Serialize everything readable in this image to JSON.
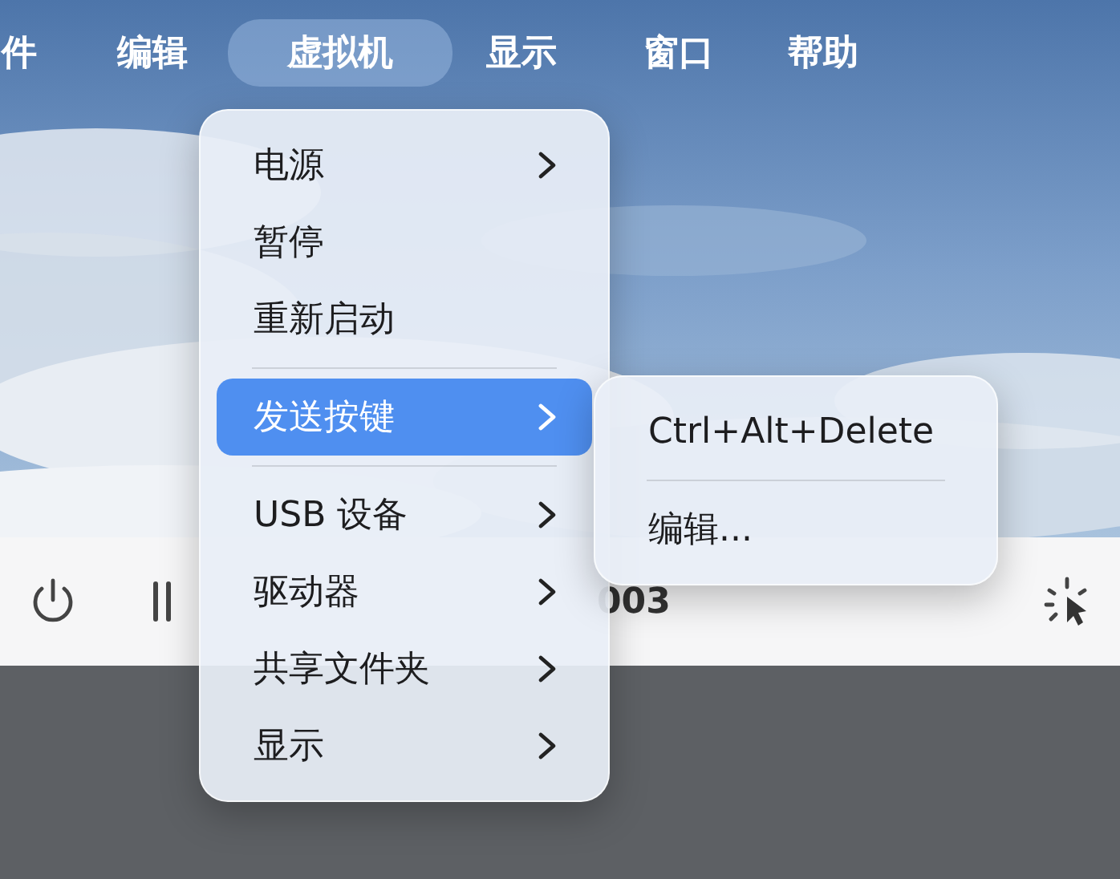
{
  "menu_bar": [
    {
      "label": "件",
      "selected": false
    },
    {
      "label": "编辑",
      "selected": false
    },
    {
      "label": "虚拟机",
      "selected": true
    },
    {
      "label": "显示",
      "selected": false
    },
    {
      "label": "窗口",
      "selected": false
    },
    {
      "label": "帮助",
      "selected": false
    }
  ],
  "menu": {
    "items": [
      {
        "kind": "item",
        "label": "电源",
        "submenu": true,
        "selected": false
      },
      {
        "kind": "item",
        "label": "暂停",
        "submenu": false,
        "selected": false
      },
      {
        "kind": "item",
        "label": "重新启动",
        "submenu": false,
        "selected": false
      },
      {
        "kind": "separator"
      },
      {
        "kind": "item",
        "label": "发送按键",
        "submenu": true,
        "selected": true
      },
      {
        "kind": "separator"
      },
      {
        "kind": "item",
        "label": "USB 设备",
        "submenu": true,
        "selected": false
      },
      {
        "kind": "item",
        "label": "驱动器",
        "submenu": true,
        "selected": false
      },
      {
        "kind": "item",
        "label": "共享文件夹",
        "submenu": true,
        "selected": false
      },
      {
        "kind": "item",
        "label": "显示",
        "submenu": true,
        "selected": false
      }
    ]
  },
  "submenu": {
    "items": [
      {
        "kind": "item",
        "label": "Ctrl+Alt+Delete",
        "submenu": false,
        "selected": false
      },
      {
        "kind": "separator"
      },
      {
        "kind": "item",
        "label": "编辑...",
        "submenu": false,
        "selected": false
      }
    ]
  },
  "toolbar": {
    "title": "003"
  }
}
